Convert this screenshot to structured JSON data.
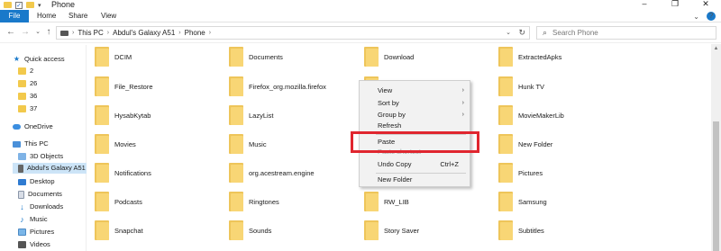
{
  "window": {
    "title": "Phone",
    "controls": [
      "–",
      "❐",
      "✕"
    ]
  },
  "ribbon": {
    "tabs": [
      "File",
      "Home",
      "Share",
      "View"
    ],
    "help": "?"
  },
  "address": {
    "crumbs": [
      "This PC",
      "Abdul's Galaxy A51",
      "Phone"
    ],
    "search_placeholder": "Search Phone"
  },
  "sidebar": {
    "items": [
      {
        "label": "Quick access",
        "icon": "star-icon"
      },
      {
        "label": "2",
        "icon": "folder-icon"
      },
      {
        "label": "26",
        "icon": "folder-icon"
      },
      {
        "label": "36",
        "icon": "folder-icon"
      },
      {
        "label": "37",
        "icon": "folder-icon"
      },
      {
        "label": "OneDrive",
        "icon": "cloud-icon"
      },
      {
        "label": "This PC",
        "icon": "computer-icon"
      },
      {
        "label": "3D Objects",
        "icon": "cube-icon"
      },
      {
        "label": "Abdul's Galaxy A51",
        "icon": "phone-icon"
      },
      {
        "label": "Desktop",
        "icon": "desktop-icon"
      },
      {
        "label": "Documents",
        "icon": "documents-icon"
      },
      {
        "label": "Downloads",
        "icon": "download-icon"
      },
      {
        "label": "Music",
        "icon": "music-icon"
      },
      {
        "label": "Pictures",
        "icon": "pictures-icon"
      },
      {
        "label": "Videos",
        "icon": "videos-icon"
      }
    ],
    "selected": "Abdul's Galaxy A51"
  },
  "files": [
    "DCIM",
    "Documents",
    "Download",
    "ExtractedApks",
    "File_Restore",
    "Firefox_org.mozilla.firefox",
    "",
    "Hunk TV",
    "HysabKytab",
    "LazyList",
    "...dunya",
    "MovieMakerLib",
    "Movies",
    "Music",
    "",
    "New Folder",
    "Notifications",
    "org.acestream.engine",
    "",
    "Pictures",
    "Podcasts",
    "Ringtones",
    "RW_LIB",
    "Samsung",
    "Snapchat",
    "Sounds",
    "Story Saver",
    "Subtitles"
  ],
  "context_menu": {
    "items": [
      {
        "label": "View",
        "submenu": true
      },
      {
        "label": "Sort by",
        "submenu": true
      },
      {
        "label": "Group by",
        "submenu": true
      },
      {
        "label": "Refresh"
      },
      {
        "label": "Paste"
      },
      {
        "label": "Paste shortcut",
        "disabled": true
      },
      {
        "label": "Undo Copy",
        "shortcut": "Ctrl+Z"
      },
      {
        "label": "New Folder"
      }
    ]
  },
  "colors": {
    "accent": "#1979ca",
    "highlight": "#e0262f",
    "selection": "#cce4f7",
    "folder": "#f8d675"
  }
}
